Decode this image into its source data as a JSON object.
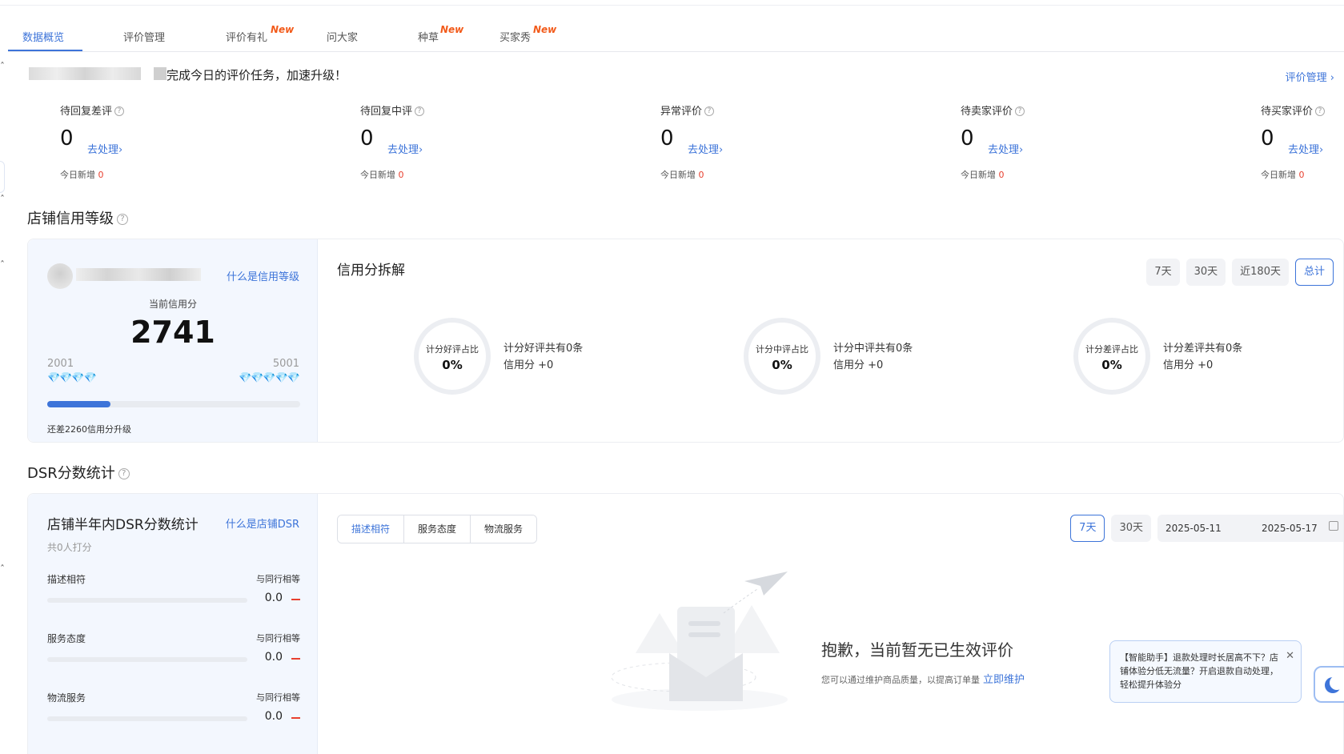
{
  "tabs": [
    {
      "label": "数据概览",
      "new": ""
    },
    {
      "label": "评价管理",
      "new": ""
    },
    {
      "label": "评价有礼",
      "new": "New"
    },
    {
      "label": "问大家",
      "new": ""
    },
    {
      "label": "种草",
      "new": "New"
    },
    {
      "label": "买家秀",
      "new": "New"
    }
  ],
  "greeting": {
    "text": "完成今日的评价任务，加速升级！",
    "link": "评价管理 ›"
  },
  "stats": [
    {
      "label": "待回复差评",
      "value": "0",
      "link": "去处理›",
      "today_label": "今日新增 ",
      "today_value": "0"
    },
    {
      "label": "待回复中评",
      "value": "0",
      "link": "去处理›",
      "today_label": "今日新增 ",
      "today_value": "0"
    },
    {
      "label": "异常评价",
      "value": "0",
      "link": "去处理›",
      "today_label": "今日新增 ",
      "today_value": "0"
    },
    {
      "label": "待卖家评价",
      "value": "0",
      "link": "去处理›",
      "today_label": "今日新增 ",
      "today_value": "0"
    },
    {
      "label": "待买家评价",
      "value": "0",
      "link": "去处理›",
      "today_label": "今日新增 ",
      "today_value": "0"
    }
  ],
  "credit": {
    "section_title": "店铺信用等级",
    "what_link": "什么是信用等级",
    "current_label": "当前信用分",
    "score": "2741",
    "level_low": "2001",
    "level_high": "5001",
    "diamonds_blue": "💎💎💎💎",
    "diamonds_grey": "💎💎💎💎💎",
    "progress": 0.25,
    "need_text": "还差2260信用分升级",
    "breakdown_title": "信用分拆解",
    "ranges": [
      "7天",
      "30天",
      "近180天",
      "总计"
    ],
    "active_range": "总计",
    "rings": [
      {
        "label": "计分好评占比",
        "value": "0%",
        "line1": "计分好评共有0条",
        "line2": "信用分 +0"
      },
      {
        "label": "计分中评占比",
        "value": "0%",
        "line1": "计分中评共有0条",
        "line2": "信用分 +0"
      },
      {
        "label": "计分差评占比",
        "value": "0%",
        "line1": "计分差评共有0条",
        "line2": "信用分 +0"
      }
    ]
  },
  "dsr": {
    "section_title": "DSR分数统计",
    "panel_title": "店铺半年内DSR分数统计",
    "what_link": "什么是店铺DSR",
    "count_text": "共0人打分",
    "items": [
      {
        "name": "描述相符",
        "compare": "与同行相等",
        "value": "0.0"
      },
      {
        "name": "服务态度",
        "compare": "与同行相等",
        "value": "0.0"
      },
      {
        "name": "物流服务",
        "compare": "与同行相等",
        "value": "0.0"
      }
    ],
    "seg_tabs": [
      "描述相符",
      "服务态度",
      "物流服务"
    ],
    "ranges": [
      "7天",
      "30天"
    ],
    "date_start": "2025-05-11",
    "date_end": "2025-05-17",
    "empty_title": "抱歉，当前暂无已生效评价",
    "empty_sub": "您可以通过维护商品质量，以提高订单量",
    "empty_link": "立即维护"
  },
  "assistant": {
    "text": "【智能助手】退款处理时长居高不下？店铺体验分低无流量？开启退款自动处理，轻松提升体验分",
    "close": "✕"
  },
  "colors": {
    "accent": "#3d74d9",
    "new_badge": "#f25b1b",
    "alert": "#e8402f"
  }
}
